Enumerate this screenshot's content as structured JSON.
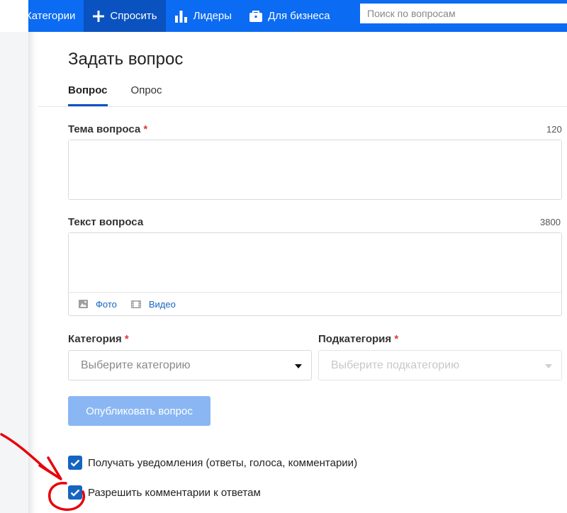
{
  "nav": {
    "categories_label": "Категории",
    "ask_label": "Спросить",
    "leaders_label": "Лидеры",
    "business_label": "Для бизнеса",
    "search_placeholder": "Поиск по вопросам"
  },
  "page": {
    "title": "Задать вопрос",
    "tabs": [
      {
        "label": "Вопрос",
        "active": true
      },
      {
        "label": "Опрос",
        "active": false
      }
    ]
  },
  "form": {
    "topic": {
      "label": "Тема вопроса",
      "required_mark": "*",
      "counter": "120",
      "value": ""
    },
    "text": {
      "label": "Текст вопроса",
      "counter": "3800",
      "value": ""
    },
    "attachments": [
      {
        "label": "Фото",
        "icon": "image-icon"
      },
      {
        "label": "Видео",
        "icon": "film-icon"
      }
    ],
    "category": {
      "label": "Категория",
      "required_mark": "*",
      "placeholder": "Выберите категорию"
    },
    "subcategory": {
      "label": "Подкатегория",
      "required_mark": "*",
      "placeholder": "Выберите подкатегорию",
      "disabled": true
    },
    "publish_label": "Опубликовать вопрос",
    "checkboxes": [
      {
        "label": "Получать уведомления (ответы, голоса, комментарии)",
        "checked": true
      },
      {
        "label": "Разрешить комментарии к ответам",
        "checked": true
      }
    ]
  },
  "colors": {
    "nav_bg": "#0b6bf2",
    "nav_active": "#0a52c0",
    "accent": "#1565c0",
    "required": "#e43636",
    "publish_disabled": "#8ab7f3",
    "annotation": "#e8000b"
  }
}
